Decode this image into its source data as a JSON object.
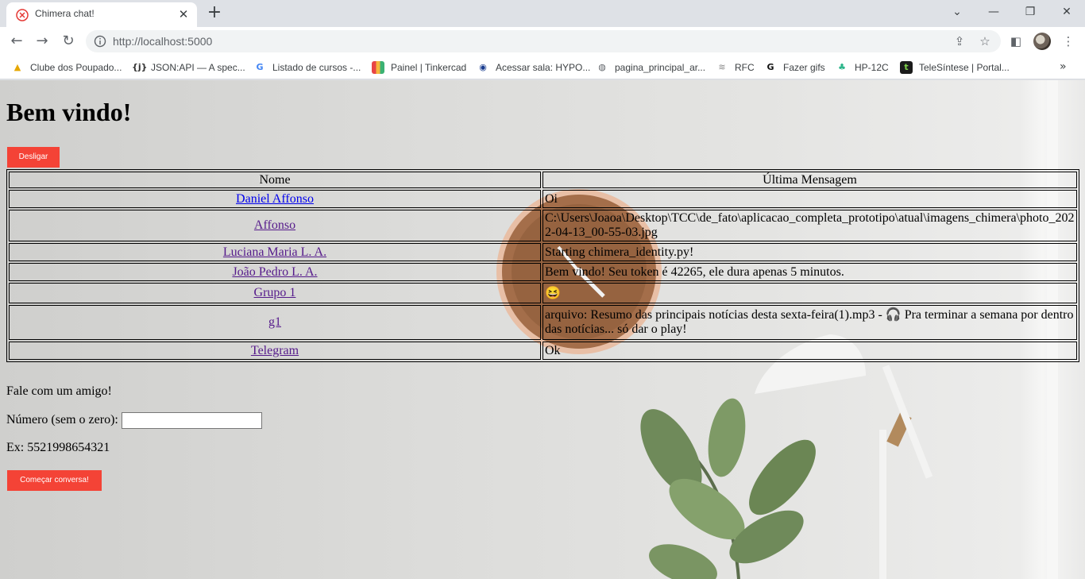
{
  "browser": {
    "tab_title": "Chimera chat!",
    "url": "http://localhost:5000",
    "bookmarks": [
      {
        "label": "Clube dos Poupado...",
        "icon": "bank-icon"
      },
      {
        "label": "JSON:API — A spec...",
        "icon": "json-icon"
      },
      {
        "label": "Listado de cursos -...",
        "icon": "google-icon"
      },
      {
        "label": "Painel | Tinkercad",
        "icon": "tinkercad-icon"
      },
      {
        "label": "Acessar sala: HYPO...",
        "icon": "owl-icon"
      },
      {
        "label": "pagina_principal_ar...",
        "icon": "globe-icon"
      },
      {
        "label": "RFC",
        "icon": "rfc-icon"
      },
      {
        "label": "Fazer gifs",
        "icon": "g-icon"
      },
      {
        "label": "HP-12C",
        "icon": "leaf-icon"
      },
      {
        "label": "TeleSíntese | Portal...",
        "icon": "telesintese-icon"
      }
    ]
  },
  "page": {
    "title": "Bem vindo!",
    "disconnect_label": "Desligar",
    "table": {
      "headers": [
        "Nome",
        "Última Mensagem"
      ],
      "rows": [
        {
          "name": "Daniel Affonso",
          "message": "Oi"
        },
        {
          "name": "Affonso",
          "message": "C:\\Users\\Joaoa\\Desktop\\TCC\\de_fato\\aplicacao_completa_prototipo\\atual\\imagens_chimera\\photo_2022-04-13_00-55-03.jpg"
        },
        {
          "name": "Luciana Maria L. A.",
          "message": "Starting chimera_identity.py!"
        },
        {
          "name": "João Pedro L. A.",
          "message": "Bem vindo! Seu token é 42265, ele dura apenas 5 minutos."
        },
        {
          "name": "Grupo 1",
          "message": "😆"
        },
        {
          "name": "g1",
          "message": "arquivo: Resumo das principais notícias desta sexta-feira(1).mp3 - 🎧 Pra terminar a semana por dentro das notícias... só dar o play!"
        },
        {
          "name": "Telegram",
          "message": "Ok"
        }
      ]
    },
    "talk_heading": "Fale com um amigo!",
    "number_label": "Número (sem o zero):",
    "number_value": "",
    "example_text": "Ex: 5521998654321",
    "start_label": "Começar conversa!"
  }
}
